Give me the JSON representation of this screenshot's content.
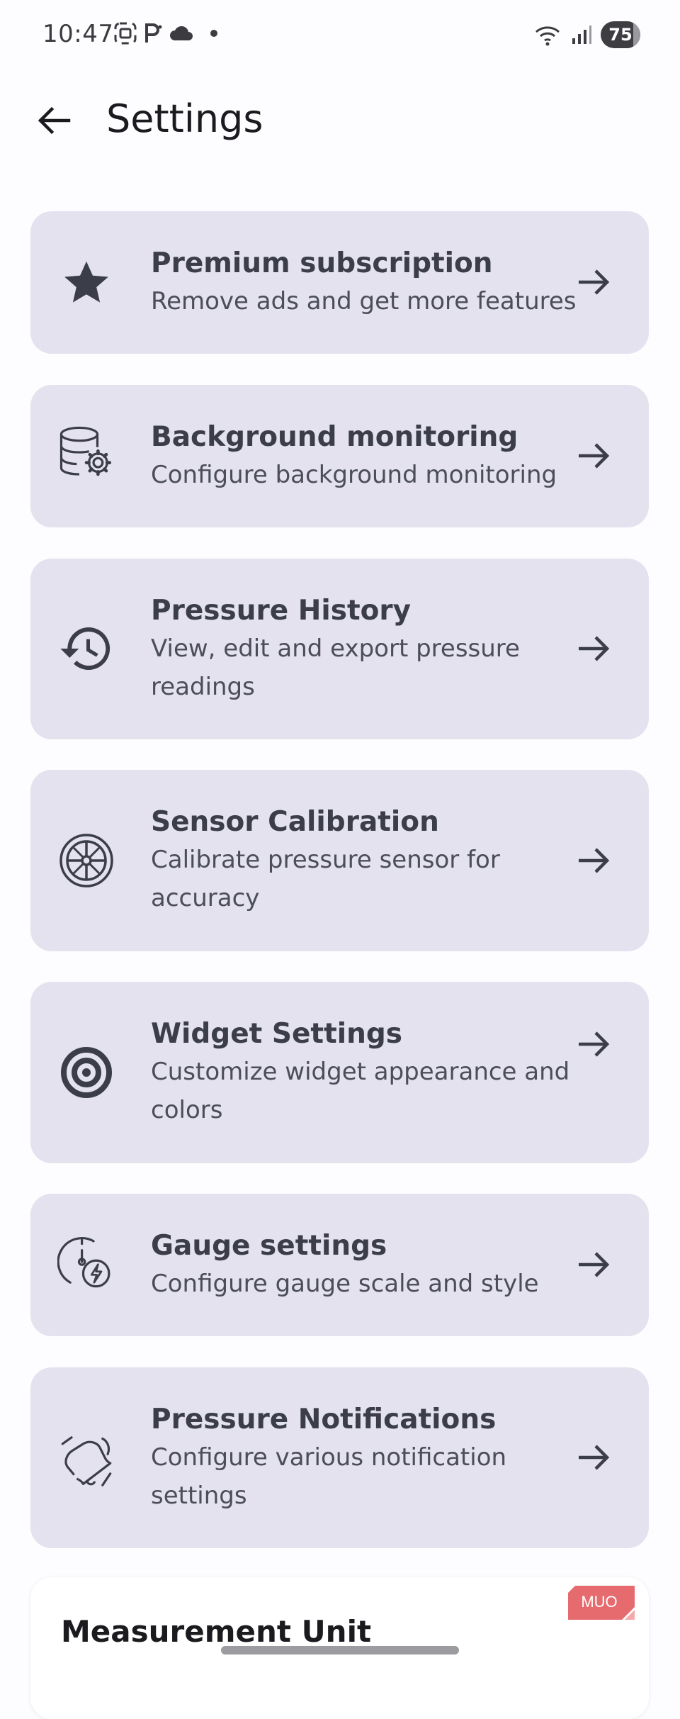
{
  "status_bar": {
    "time": "10:47",
    "battery": "75",
    "icons_left": [
      "screenshot-icon",
      "parking-icon",
      "cloud-icon",
      "dot-icon"
    ],
    "icons_right": [
      "wifi-icon",
      "signal-icon",
      "battery-icon"
    ]
  },
  "app_bar": {
    "title": "Settings"
  },
  "cards": [
    {
      "id": "premium",
      "title": "Premium subscription",
      "subtitle": "Remove ads and get more features",
      "icon": "star-icon"
    },
    {
      "id": "background",
      "title": "Background monitoring",
      "subtitle": "Configure background monitoring",
      "icon": "database-gear-icon"
    },
    {
      "id": "history",
      "title": "Pressure History",
      "subtitle": "View, edit and export pressure readings",
      "icon": "history-icon"
    },
    {
      "id": "calibration",
      "title": "Sensor Calibration",
      "subtitle": "Calibrate pressure sensor for accuracy",
      "icon": "crosshair-icon"
    },
    {
      "id": "widget",
      "title": "Widget Settings",
      "subtitle": "Customize widget appearance and colors",
      "icon": "target-icon"
    },
    {
      "id": "gauge",
      "title": "Gauge settings",
      "subtitle": "Configure gauge scale and style",
      "icon": "gauge-bolt-icon"
    },
    {
      "id": "notifications",
      "title": "Pressure Notifications",
      "subtitle": "Configure various notification settings",
      "icon": "bell-off-icon"
    }
  ],
  "measurement": {
    "title": "Measurement Unit"
  },
  "watermark": "MUO",
  "colors": {
    "card_bg": "#e3e2ee",
    "page_bg": "#fdfcff",
    "icon": "#3b3d48",
    "watermark": "#e56b6f"
  }
}
